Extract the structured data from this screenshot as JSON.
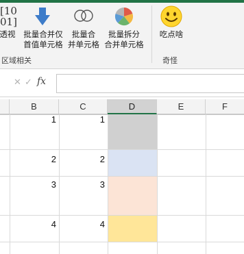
{
  "ribbon": {
    "buttons": [
      {
        "label_line1": "透视",
        "label_line2": "",
        "icon": "matrix-transpose-icon"
      },
      {
        "label_line1": "批量合并仅",
        "label_line2": "首值单元格",
        "icon": "arrow-down-icon"
      },
      {
        "label_line1": "批量合",
        "label_line2": "并单元格",
        "icon": "merge-circles-icon"
      },
      {
        "label_line1": "批量拆分",
        "label_line2": "合并单元格",
        "icon": "pie-split-icon"
      },
      {
        "label_line1": "吃点啥",
        "label_line2": "",
        "icon": "smiley-icon"
      }
    ],
    "groups": {
      "range": "区域相关",
      "fun": "奇怪"
    },
    "matrix_glyph": {
      "row1": "[10",
      "row2": "01]"
    }
  },
  "formula_bar": {
    "cancel_glyph": "✕",
    "enter_glyph": "✓",
    "fx_label": "fx",
    "content": ""
  },
  "sheet": {
    "columns": [
      "B",
      "C",
      "D",
      "E",
      "F"
    ],
    "selected_column": "D",
    "rows": [
      {
        "b": "1",
        "c": "1",
        "fill": "#d0d0d0"
      },
      {
        "b": "2",
        "c": "2",
        "fill": "#dae3f3"
      },
      {
        "b": "3",
        "c": "3",
        "fill": "#fce4d6"
      },
      {
        "b": "4",
        "c": "4",
        "fill": "#ffe699"
      }
    ]
  }
}
